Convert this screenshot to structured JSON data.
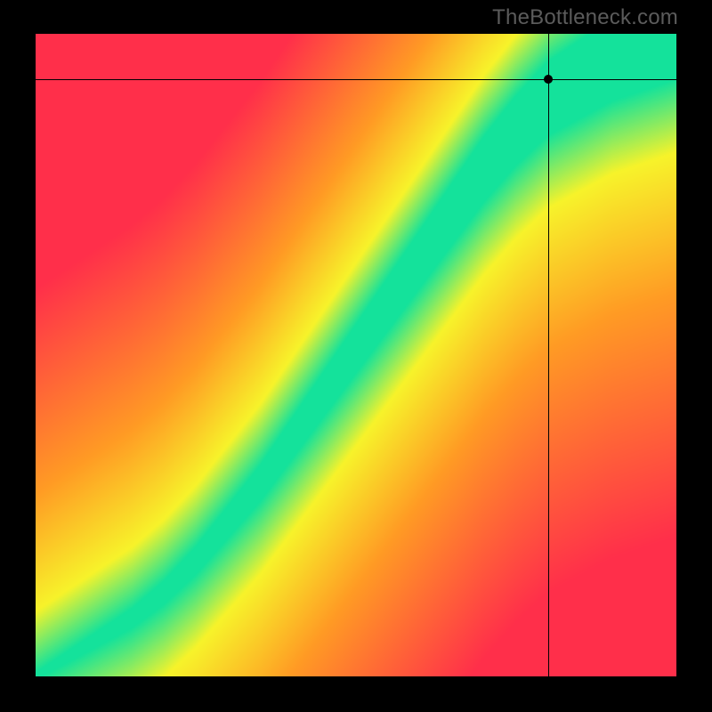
{
  "watermark": "TheBottleneck.com",
  "chart_data": {
    "type": "heatmap",
    "title": "",
    "xlabel": "",
    "ylabel": "",
    "xlim": [
      0,
      1
    ],
    "ylim": [
      0,
      1
    ],
    "colorscale_description": "red (worst) → orange → yellow → green (optimal) → yellow → orange → red; green band marks balanced pairing",
    "optimal_curve": [
      {
        "x": 0.0,
        "y": 0.0
      },
      {
        "x": 0.05,
        "y": 0.03
      },
      {
        "x": 0.1,
        "y": 0.06
      },
      {
        "x": 0.15,
        "y": 0.09
      },
      {
        "x": 0.2,
        "y": 0.13
      },
      {
        "x": 0.25,
        "y": 0.18
      },
      {
        "x": 0.3,
        "y": 0.24
      },
      {
        "x": 0.35,
        "y": 0.3
      },
      {
        "x": 0.4,
        "y": 0.37
      },
      {
        "x": 0.45,
        "y": 0.44
      },
      {
        "x": 0.5,
        "y": 0.51
      },
      {
        "x": 0.55,
        "y": 0.58
      },
      {
        "x": 0.6,
        "y": 0.65
      },
      {
        "x": 0.65,
        "y": 0.72
      },
      {
        "x": 0.7,
        "y": 0.79
      },
      {
        "x": 0.75,
        "y": 0.85
      },
      {
        "x": 0.8,
        "y": 0.9
      },
      {
        "x": 0.85,
        "y": 0.93
      },
      {
        "x": 0.9,
        "y": 0.96
      },
      {
        "x": 0.95,
        "y": 0.98
      },
      {
        "x": 1.0,
        "y": 1.0
      }
    ],
    "band_halfwidth_start": 0.005,
    "band_halfwidth_end": 0.07,
    "marker": {
      "x": 0.8,
      "y": 0.93
    },
    "crosshair": {
      "x": 0.8,
      "y": 0.93
    }
  },
  "colors": {
    "green": "#14e29b",
    "yellow": "#f7f32a",
    "orange": "#ff9b24",
    "red": "#ff2f4a",
    "background": "#000000",
    "watermark": "#5b5b5b"
  }
}
